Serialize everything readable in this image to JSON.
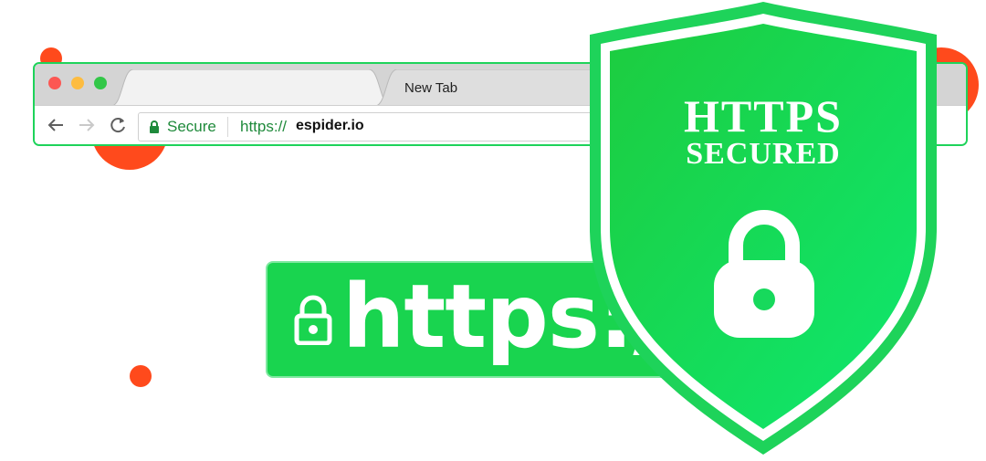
{
  "colors": {
    "accent": "#ff4a1c",
    "green": "#19d44f",
    "green_light": "#12e36a",
    "secure_text": "#1f8a3b"
  },
  "browser": {
    "window_controls": [
      "close",
      "minimize",
      "maximize"
    ],
    "tabs": [
      {
        "title": "",
        "active": true,
        "close_icon": "×"
      },
      {
        "title": "New Tab",
        "active": false
      }
    ],
    "nav": {
      "back_icon": "arrow-left",
      "forward_icon": "arrow-right",
      "reload_icon": "reload"
    },
    "address_bar": {
      "secure_label": "Secure",
      "scheme": "https://",
      "host": "espider.io"
    }
  },
  "banner": {
    "text": "https://"
  },
  "shield": {
    "title": "HTTPS",
    "subtitle": "SECURED"
  }
}
